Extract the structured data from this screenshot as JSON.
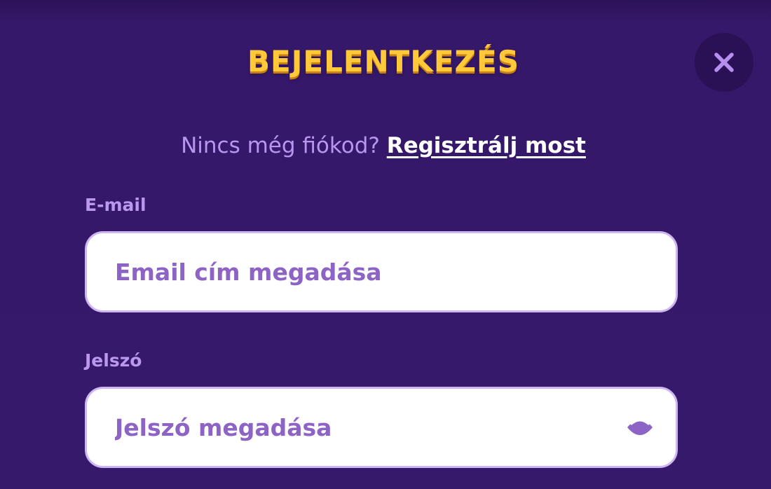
{
  "modal": {
    "title": "BEJELENTKEZÉS",
    "close_icon": "close-icon"
  },
  "signup": {
    "prompt": "Nincs még fiókod?",
    "link_label": "Regisztrálj most"
  },
  "form": {
    "email": {
      "label": "E-mail",
      "placeholder": "Email cím megadása",
      "value": ""
    },
    "password": {
      "label": "Jelszó",
      "placeholder": "Jelszó megadása",
      "value": "",
      "toggle_icon": "eye-icon"
    }
  },
  "colors": {
    "background": "#35186a",
    "title": "#ffc93a",
    "label": "#b998ee",
    "placeholder": "#8d63c6",
    "input_border": "#cdb6f2",
    "link": "#ffffff"
  }
}
